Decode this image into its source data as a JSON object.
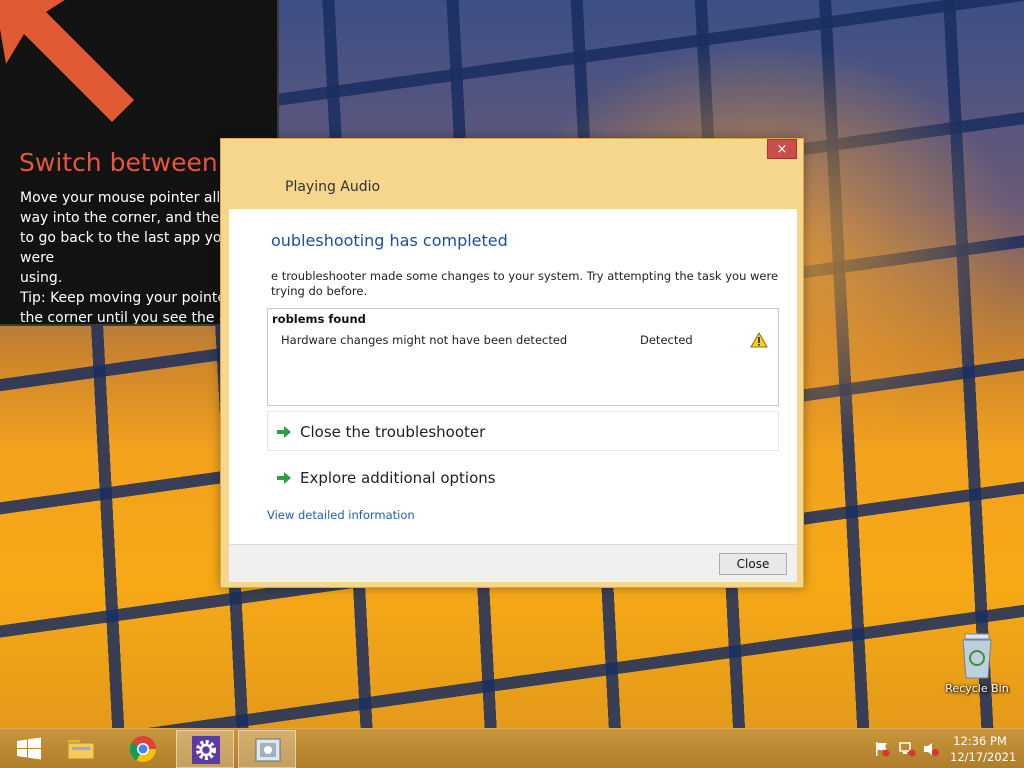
{
  "tip": {
    "title": "Switch between apps",
    "body_lines": [
      "Move your mouse pointer all the",
      "way into the corner, and then click",
      "to go back to the last app you were",
      "using.",
      "Tip: Keep moving your pointer into",
      "the corner until you see the app."
    ]
  },
  "dialog": {
    "close_glyph": "×",
    "title": "Playing Audio",
    "heading": "oubleshooting has completed",
    "description": "e troubleshooter made some changes to your system. Try attempting the task you were trying do before.",
    "problems_title": "roblems found",
    "problem": {
      "name": "Hardware changes might not have been detected",
      "status": "Detected",
      "icon": "warning-icon"
    },
    "actions": [
      {
        "label": "Close the troubleshooter",
        "icon": "green-arrow-icon"
      },
      {
        "label": "Explore additional options",
        "icon": "green-arrow-icon"
      }
    ],
    "link": "View detailed information",
    "button": "Close"
  },
  "desktop": {
    "recycle_bin_label": "Recycle Bin"
  },
  "taskbar": {
    "items": [
      {
        "name": "start-button",
        "icon": "windows-logo-icon",
        "active": false
      },
      {
        "name": "file-explorer",
        "icon": "folder-icon",
        "active": false
      },
      {
        "name": "chrome",
        "icon": "chrome-icon",
        "active": false
      },
      {
        "name": "settings",
        "icon": "gear-icon",
        "active": true
      },
      {
        "name": "troubleshooter",
        "icon": "troubleshooter-icon",
        "active": true
      }
    ],
    "tray": [
      "action-center-flag-icon",
      "network-icon",
      "volume-muted-icon"
    ],
    "time": "12:36 PM",
    "date": "12/17/2021"
  },
  "colors": {
    "tip_title": "#e8563a",
    "dialog_frame": "#f6d58d",
    "heading_blue": "#1b4f9a",
    "link_blue": "#1d62b0",
    "close_red": "#c7504c",
    "taskbar": "#b8862f"
  }
}
